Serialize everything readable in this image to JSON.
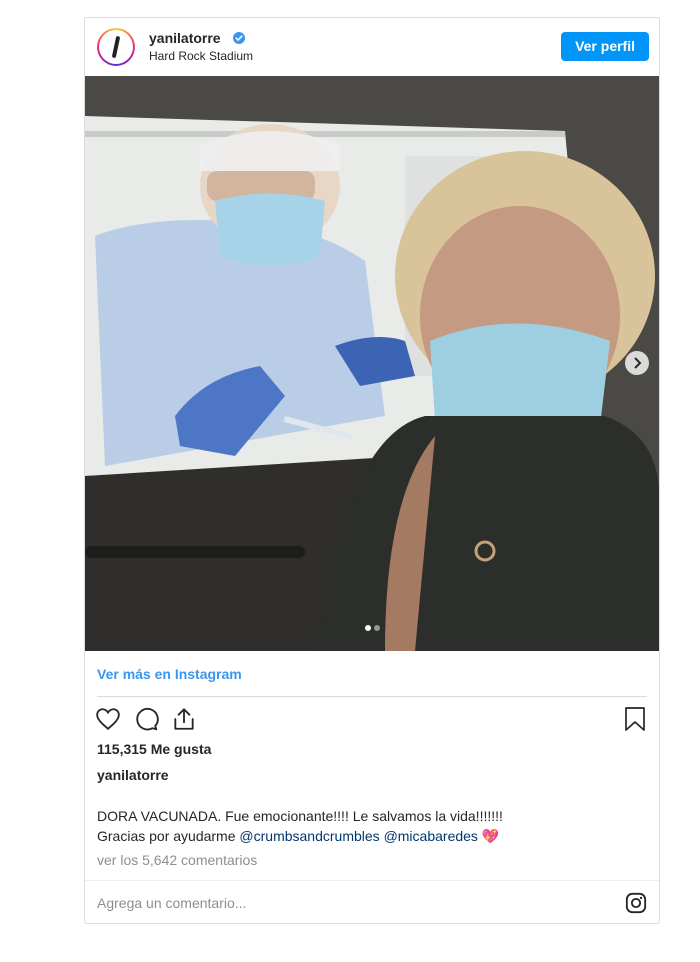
{
  "post": {
    "username": "yanilatorre",
    "location": "Hard Rock Stadium",
    "follow_label": "Ver perfil",
    "view_more_label": "Ver más en Instagram",
    "likes_text": "115,315 Me gusta",
    "author": "yanilatorre",
    "caption_line1": "DORA VACUNADA. Fue emocionante!!!! Le salvamos la vida!!!!!!!",
    "caption_line2_prefix": "Gracias por ayudarme",
    "mention1": "@crumbsandcrumbles",
    "mention2": "@micabaredes",
    "emoji": "💖",
    "view_comments": "ver los 5,642 comentarios",
    "comment_placeholder": "Agrega un comentario...",
    "carousel": {
      "current": 1,
      "total": 2
    }
  },
  "colors": {
    "accent": "#0095f6",
    "link": "#3897f0",
    "mention": "#00376b",
    "muted": "#8e8e8e"
  },
  "icons": [
    "verified-badge-icon",
    "next-arrow-icon",
    "heart-icon",
    "comment-icon",
    "share-icon",
    "bookmark-icon",
    "instagram-logo-icon"
  ]
}
